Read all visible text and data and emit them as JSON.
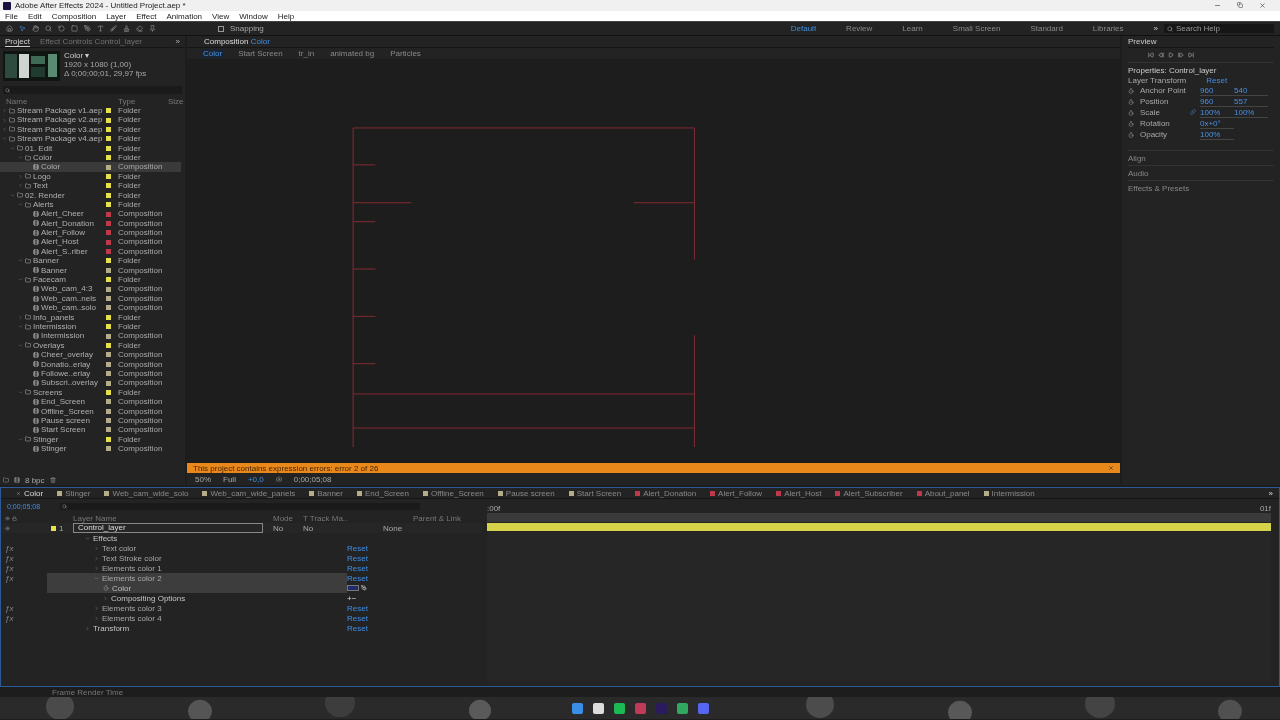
{
  "window": {
    "title": "Adobe After Effects 2024 - Untitled Project.aep *"
  },
  "menu": [
    "File",
    "Edit",
    "Composition",
    "Layer",
    "Effect",
    "Animation",
    "View",
    "Window",
    "Help"
  ],
  "toolbar": {
    "snapping": {
      "label": "Snapping",
      "checked": false
    },
    "workspaces": [
      {
        "label": "Default",
        "selected": true
      },
      {
        "label": "Review",
        "selected": false
      },
      {
        "label": "Learn",
        "selected": false
      },
      {
        "label": "Small Screen",
        "selected": false
      },
      {
        "label": "Standard",
        "selected": false
      },
      {
        "label": "Libraries",
        "selected": false
      }
    ],
    "more": "»",
    "search": {
      "placeholder": "Search Help"
    }
  },
  "project": {
    "tabs": [
      {
        "label": "Project",
        "selected": true
      },
      {
        "label": "Effect Controls Control_layer",
        "selected": false
      }
    ],
    "more": "»",
    "info": {
      "name": "Color ▾",
      "size": "1920 x 1080 (1,00)",
      "duration": "Δ 0;00;00;01, 29,97 fps"
    },
    "columns": [
      "Name",
      "Type",
      "Size"
    ],
    "items": [
      {
        "name": "Stream Package v1.aep",
        "kind": "folder",
        "type": "Folder",
        "color": "#e6e04a",
        "expanded": false,
        "selected": false
      },
      {
        "name": "Stream Package v2.aep",
        "kind": "folder",
        "type": "Folder",
        "color": "#e6e04a",
        "expanded": false,
        "selected": false
      },
      {
        "name": "Stream Package v3.aep",
        "kind": "folder",
        "type": "Folder",
        "color": "#e6e04a",
        "expanded": false,
        "selected": false
      },
      {
        "name": "Stream Package v4.aep",
        "kind": "folder",
        "type": "Folder",
        "color": "#e6e04a",
        "expanded": true,
        "selected": false,
        "children": [
          {
            "name": "01. Edit",
            "kind": "folder",
            "type": "Folder",
            "color": "#e6e04a",
            "expanded": true,
            "selected": false,
            "children": [
              {
                "name": "Color",
                "kind": "folder",
                "type": "Folder",
                "color": "#e6e04a",
                "expanded": true,
                "selected": false,
                "children": [
                  {
                    "name": "Color",
                    "kind": "composition",
                    "type": "Composition",
                    "color": "#b5ac8a",
                    "selected": true
                  }
                ]
              },
              {
                "name": "Logo",
                "kind": "folder",
                "type": "Folder",
                "color": "#e6e04a",
                "expanded": false,
                "selected": false
              },
              {
                "name": "Text",
                "kind": "folder",
                "type": "Folder",
                "color": "#e6e04a",
                "expanded": false,
                "selected": false
              }
            ]
          },
          {
            "name": "02. Render",
            "kind": "folder",
            "type": "Folder",
            "color": "#e6e04a",
            "expanded": true,
            "selected": false,
            "children": [
              {
                "name": "Alerts",
                "kind": "folder",
                "type": "Folder",
                "color": "#e6e04a",
                "expanded": true,
                "selected": false,
                "children": [
                  {
                    "name": "Alert_Cheer",
                    "kind": "composition",
                    "type": "Composition",
                    "color": "#c0394a",
                    "selected": false
                  },
                  {
                    "name": "Alert_Donation",
                    "kind": "composition",
                    "type": "Composition",
                    "color": "#c0394a",
                    "selected": false
                  },
                  {
                    "name": "Alert_Follow",
                    "kind": "composition",
                    "type": "Composition",
                    "color": "#c0394a",
                    "selected": false
                  },
                  {
                    "name": "Alert_Host",
                    "kind": "composition",
                    "type": "Composition",
                    "color": "#c0394a",
                    "selected": false
                  },
                  {
                    "name": "Alert_S..riber",
                    "kind": "composition",
                    "type": "Composition",
                    "color": "#c0394a",
                    "selected": false
                  }
                ]
              },
              {
                "name": "Banner",
                "kind": "folder",
                "type": "Folder",
                "color": "#e6e04a",
                "expanded": true,
                "selected": false,
                "children": [
                  {
                    "name": "Banner",
                    "kind": "composition",
                    "type": "Composition",
                    "color": "#b5ac8a",
                    "selected": false
                  }
                ]
              },
              {
                "name": "Facecam",
                "kind": "folder",
                "type": "Folder",
                "color": "#e6e04a",
                "expanded": true,
                "selected": false,
                "children": [
                  {
                    "name": "Web_cam_4:3",
                    "kind": "composition",
                    "type": "Composition",
                    "color": "#b5ac8a",
                    "selected": false
                  },
                  {
                    "name": "Web_cam..nels",
                    "kind": "composition",
                    "type": "Composition",
                    "color": "#b5ac8a",
                    "selected": false
                  },
                  {
                    "name": "Web_cam..solo",
                    "kind": "composition",
                    "type": "Composition",
                    "color": "#b5ac8a",
                    "selected": false
                  }
                ]
              },
              {
                "name": "Info_panels",
                "kind": "folder",
                "type": "Folder",
                "color": "#e6e04a",
                "expanded": false,
                "selected": false
              },
              {
                "name": "Intermission",
                "kind": "folder",
                "type": "Folder",
                "color": "#e6e04a",
                "expanded": true,
                "selected": false,
                "children": [
                  {
                    "name": "Intermission",
                    "kind": "composition",
                    "type": "Composition",
                    "color": "#b5ac8a",
                    "selected": false
                  }
                ]
              },
              {
                "name": "Overlays",
                "kind": "folder",
                "type": "Folder",
                "color": "#e6e04a",
                "expanded": true,
                "selected": false,
                "children": [
                  {
                    "name": "Cheer_overlay",
                    "kind": "composition",
                    "type": "Composition",
                    "color": "#b5ac8a",
                    "selected": false
                  },
                  {
                    "name": "Donatio..erlay",
                    "kind": "composition",
                    "type": "Composition",
                    "color": "#b5ac8a",
                    "selected": false
                  },
                  {
                    "name": "Followe..erlay",
                    "kind": "composition",
                    "type": "Composition",
                    "color": "#b5ac8a",
                    "selected": false
                  },
                  {
                    "name": "Subscri..overlay",
                    "kind": "composition",
                    "type": "Composition",
                    "color": "#b5ac8a",
                    "selected": false
                  }
                ]
              },
              {
                "name": "Screens",
                "kind": "folder",
                "type": "Folder",
                "color": "#e6e04a",
                "expanded": true,
                "selected": false,
                "children": [
                  {
                    "name": "End_Screen",
                    "kind": "composition",
                    "type": "Composition",
                    "color": "#b5ac8a",
                    "selected": false
                  },
                  {
                    "name": "Offline_Screen",
                    "kind": "composition",
                    "type": "Composition",
                    "color": "#b5ac8a",
                    "selected": false
                  },
                  {
                    "name": "Pause screen",
                    "kind": "composition",
                    "type": "Composition",
                    "color": "#b5ac8a",
                    "selected": false
                  },
                  {
                    "name": "Start Screen",
                    "kind": "composition",
                    "type": "Composition",
                    "color": "#b5ac8a",
                    "selected": false
                  }
                ]
              },
              {
                "name": "Stinger",
                "kind": "folder",
                "type": "Folder",
                "color": "#e6e04a",
                "expanded": true,
                "selected": false,
                "children": [
                  {
                    "name": "Stinger",
                    "kind": "composition",
                    "type": "Composition",
                    "color": "#b5ac8a",
                    "selected": false
                  }
                ]
              }
            ]
          }
        ]
      }
    ],
    "bpc": "8 bpc"
  },
  "composition": {
    "tab": {
      "label": "Composition",
      "name": "Color"
    },
    "breadcrumbs": [
      {
        "label": "Color",
        "selected": true
      },
      {
        "label": "Start Screen",
        "selected": false
      },
      {
        "label": "tr_in",
        "selected": false
      },
      {
        "label": "animated bg",
        "selected": false
      },
      {
        "label": "Particles",
        "selected": false
      }
    ],
    "error": "This project contains expression errors: error 2 of 26",
    "footer": {
      "zoom": "50%",
      "resolution": "Full",
      "exposure": "+0,0",
      "timecode": "0;00;05;08"
    }
  },
  "preview": {
    "title": "Preview"
  },
  "properties": {
    "title": "Properties: Control_layer",
    "section": "Layer Transform",
    "reset": "Reset",
    "rows": [
      {
        "label": "Anchor Point",
        "values": [
          "960",
          "540"
        ]
      },
      {
        "label": "Position",
        "values": [
          "960",
          "557"
        ]
      },
      {
        "label": "Scale",
        "values": [
          "100%",
          "100%"
        ],
        "linked": true
      },
      {
        "label": "Rotation",
        "values": [
          "0x+0°"
        ]
      },
      {
        "label": "Opacity",
        "values": [
          "100%"
        ]
      }
    ],
    "panels": [
      "Align",
      "Audio",
      "Effects & Presets"
    ]
  },
  "timeline": {
    "tabs": [
      {
        "label": "Color",
        "selected": true
      },
      {
        "label": "Stinger",
        "color": "#b5ac8a",
        "selected": false
      },
      {
        "label": "Web_cam_wide_solo",
        "color": "#b5ac8a",
        "selected": false
      },
      {
        "label": "Web_cam_wide_panels",
        "color": "#b5ac8a",
        "selected": false
      },
      {
        "label": "Banner",
        "color": "#b5ac8a",
        "selected": false
      },
      {
        "label": "End_Screen",
        "color": "#b5ac8a",
        "selected": false
      },
      {
        "label": "Offline_Screen",
        "color": "#b5ac8a",
        "selected": false
      },
      {
        "label": "Pause screen",
        "color": "#b5ac8a",
        "selected": false
      },
      {
        "label": "Start Screen",
        "color": "#b5ac8a",
        "selected": false
      },
      {
        "label": "Alert_Donation",
        "color": "#c0394a",
        "selected": false
      },
      {
        "label": "Alert_Follow",
        "color": "#c0394a",
        "selected": false
      },
      {
        "label": "Alert_Host",
        "color": "#c0394a",
        "selected": false
      },
      {
        "label": "Alert_Subscriber",
        "color": "#c0394a",
        "selected": false
      },
      {
        "label": "About_panel",
        "color": "#c0394a",
        "selected": false
      },
      {
        "label": "Intermission",
        "color": "#b5ac8a",
        "selected": false
      }
    ],
    "more": "»",
    "timecode": "0;00;05;08",
    "columns": {
      "layer_name": "Layer Name",
      "mode": "Mode",
      "t": "T",
      "track_matte": "Track Ma..",
      "parent": "Parent & Link"
    },
    "layer": {
      "index": "1",
      "name": "Control_layer",
      "color": "#e6e04a",
      "mode": "No",
      "track_matte": "No",
      "parent": "None",
      "children": [
        {
          "name": "Effects",
          "kind": "group",
          "expanded": true,
          "selected": false,
          "children": [
            {
              "name": "Text color",
              "kind": "effect",
              "badge": "ƒx",
              "reset": "Reset",
              "expanded": false,
              "selected": false
            },
            {
              "name": "Text Stroke color",
              "kind": "effect",
              "badge": "ƒx",
              "reset": "Reset",
              "expanded": false,
              "selected": false
            },
            {
              "name": "Elements color 1",
              "kind": "effect",
              "badge": "ƒx",
              "reset": "Reset",
              "expanded": false,
              "selected": false
            },
            {
              "name": "Elements color 2",
              "kind": "effect",
              "badge": "ƒx",
              "reset": "Reset",
              "expanded": true,
              "selected": true,
              "children": [
                {
                  "name": "Color",
                  "kind": "color",
                  "color": "#1f2b6b",
                  "selected": true
                },
                {
                  "name": "Compositing Options",
                  "kind": "group",
                  "expanded": false,
                  "selected": false,
                  "controls": "+−"
                }
              ]
            },
            {
              "name": "Elements color 3",
              "kind": "effect",
              "badge": "ƒx",
              "reset": "Reset",
              "expanded": false,
              "selected": false
            },
            {
              "name": "Elements color 4",
              "kind": "effect",
              "badge": "ƒx",
              "reset": "Reset",
              "expanded": false,
              "selected": false
            }
          ]
        },
        {
          "name": "Transform",
          "kind": "group",
          "reset": "Reset",
          "expanded": false,
          "selected": false
        }
      ]
    },
    "ruler": [
      ":00f",
      "01f"
    ]
  },
  "status_bar": {
    "text": "Frame Render Time"
  }
}
